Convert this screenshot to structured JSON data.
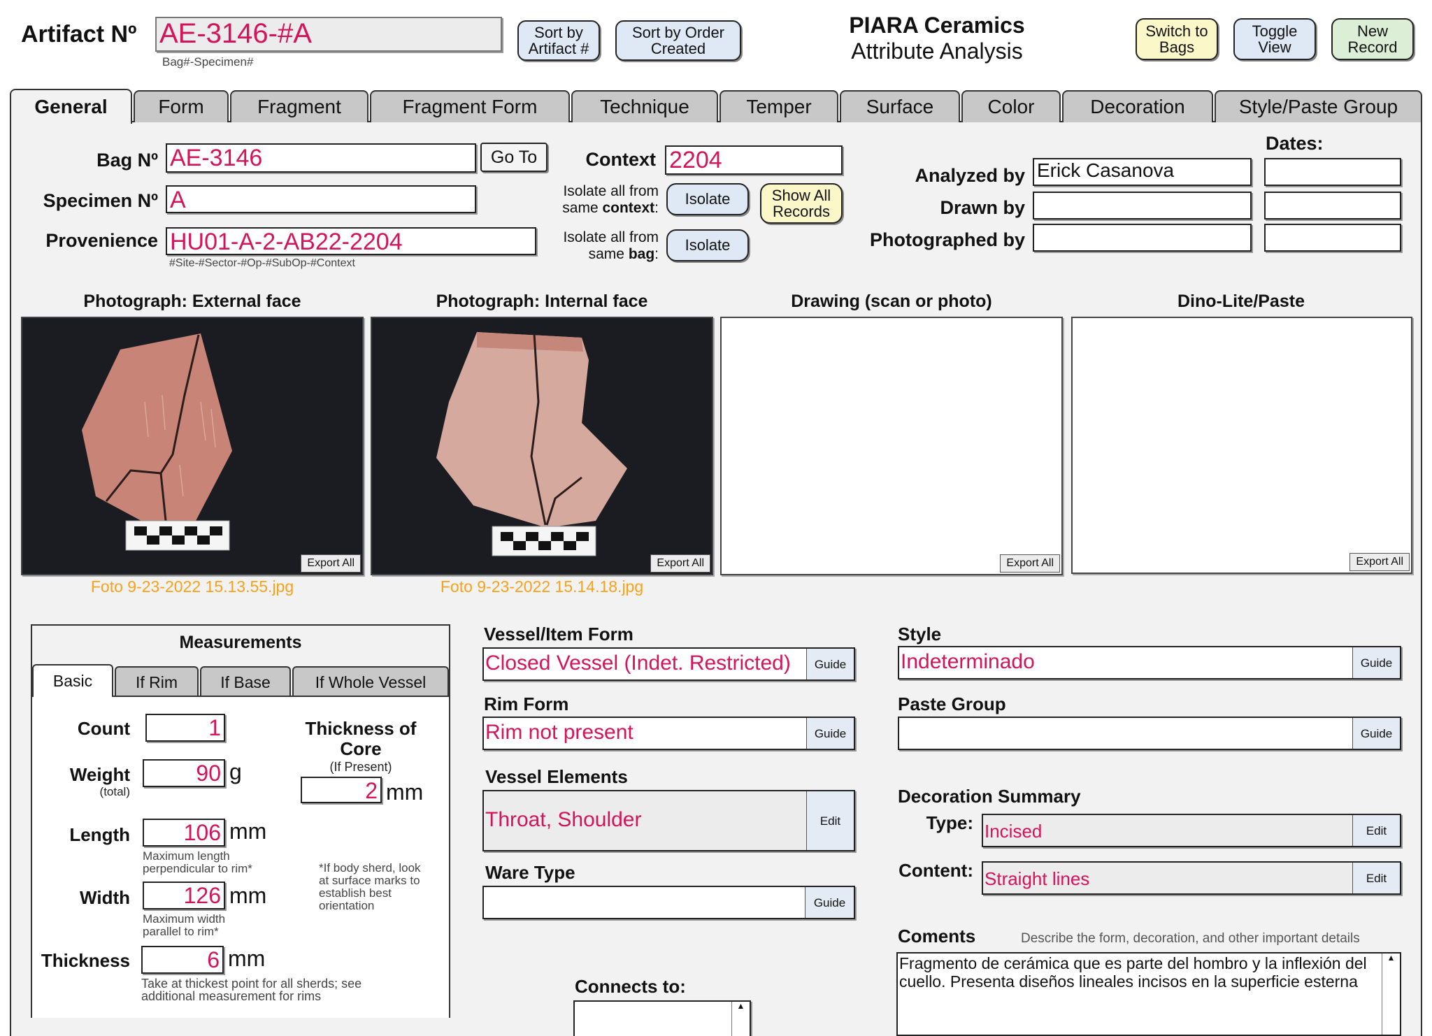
{
  "header": {
    "artifact_label": "Artifact Nº",
    "artifact_value": "AE-3146-#A",
    "artifact_hint": "Bag#-Specimen#",
    "sort_artifact": "Sort by Artifact #",
    "sort_order": "Sort by Order Created",
    "title_line1": "PIARA Ceramics",
    "title_line2": "Attribute Analysis",
    "switch_bags": "Switch to Bags",
    "toggle_view": "Toggle View",
    "new_record": "New Record"
  },
  "tabs": [
    "General",
    "Form",
    "Fragment",
    "Fragment Form",
    "Technique",
    "Temper",
    "Surface",
    "Color",
    "Decoration",
    "Style/Paste Group"
  ],
  "general": {
    "bag_label": "Bag Nº",
    "bag_value": "AE-3146",
    "goto": "Go To",
    "specimen_label": "Specimen Nº",
    "specimen_value": "A",
    "provenience_label": "Provenience",
    "provenience_value": "HU01-A-2-AB22-2204",
    "provenience_hint": "#Site-#Sector-#Op-#SubOp-#Context",
    "context_label": "Context",
    "context_value": "2204",
    "isolate_context_1": "Isolate all from",
    "isolate_context_2a": "same ",
    "isolate_context_2b": "context",
    "isolate_bag_1": "Isolate all from",
    "isolate_bag_2a": "same ",
    "isolate_bag_2b": "bag",
    "colon": ":",
    "isolate_btn": "Isolate",
    "show_all": "Show All Records",
    "dates_label": "Dates:",
    "analyzed_label": "Analyzed by",
    "analyzed_value": "Erick Casanova",
    "drawn_label": "Drawn by",
    "drawn_value": "",
    "photographed_label": "Photographed by",
    "photographed_value": ""
  },
  "images": {
    "external_title": "Photograph: External face",
    "internal_title": "Photograph: Internal face",
    "drawing_title": "Drawing (scan or photo)",
    "dino_title": "Dino-Lite/Paste",
    "export": "Export All",
    "external_file": "Foto 9-23-2022 15.13.55.jpg",
    "internal_file": "Foto 9-23-2022 15.14.18.jpg"
  },
  "measurements": {
    "title": "Measurements",
    "tabs": [
      "Basic",
      "If Rim",
      "If Base",
      "If Whole Vessel"
    ],
    "count_label": "Count",
    "count_value": "1",
    "weight_label": "Weight",
    "weight_sub": "(total)",
    "weight_value": "90",
    "weight_unit": "g",
    "length_label": "Length",
    "length_value": "106",
    "length_hint_1": "Maximum length",
    "length_hint_2": "perpendicular to rim*",
    "width_label": "Width",
    "width_value": "126",
    "width_hint_1": "Maximum width",
    "width_hint_2": "parallel to rim*",
    "thickness_label": "Thickness",
    "thickness_value": "6",
    "thickness_hint_1": "Take at thickest point for all sherds; see",
    "thickness_hint_2": "additional measurement for rims",
    "core_label_1": "Thickness of",
    "core_label_2": "Core",
    "core_sub": "(If Present)",
    "core_value": "2",
    "mm": "mm",
    "note_1": "*If body sherd, look",
    "note_2": "at surface marks to",
    "note_3": "establish best",
    "note_4": "orientation"
  },
  "form": {
    "vessel_form_label": "Vessel/Item Form",
    "vessel_form_value": "Closed Vessel (Indet. Restricted)",
    "rim_form_label": "Rim Form",
    "rim_form_value": "Rim not present",
    "vessel_elements_label": "Vessel Elements",
    "vessel_elements_value": "Throat, Shoulder",
    "ware_type_label": "Ware Type",
    "ware_type_value": "",
    "connects_label": "Connects to:",
    "guide": "Guide",
    "edit": "Edit"
  },
  "style": {
    "style_label": "Style",
    "style_value": "Indeterminado",
    "paste_label": "Paste Group",
    "paste_value": "",
    "deco_label": "Decoration Summary",
    "type_label": "Type:",
    "type_value": "Incised",
    "content_label": "Content:",
    "content_value": "Straight lines",
    "comments_label": "Coments",
    "comments_hint": "Describe the form, decoration, and other important details",
    "comments_value": "Fragmento de cerámica que es parte del hombro y la inflexión del cuello. Presenta diseños lineales incisos en la superficie esterna"
  },
  "colors": {
    "value_text": "#d4145a",
    "filename_text": "#f7a21b",
    "blue_button": "#dfe8f5",
    "yellow_button": "#fbf7c8",
    "green_button": "#dcefd6",
    "panel_bg": "#f2f2f2"
  }
}
